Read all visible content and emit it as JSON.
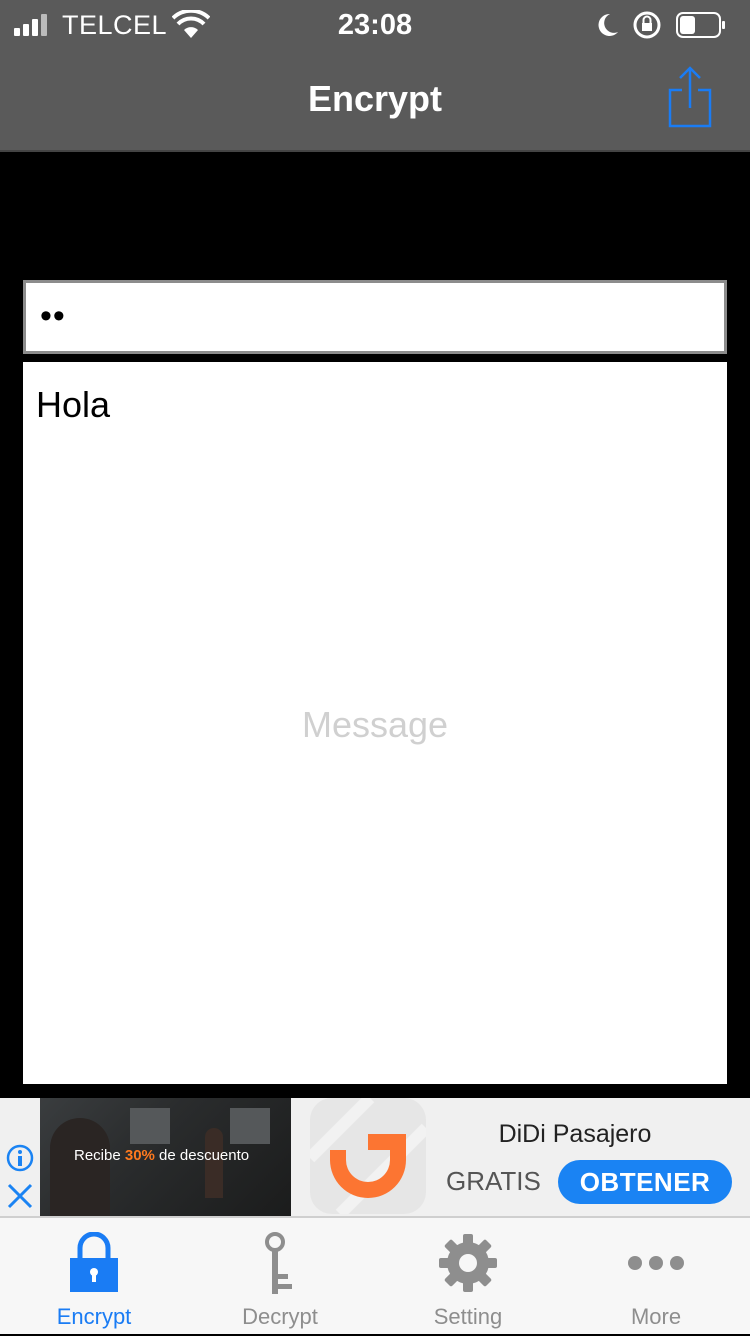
{
  "status": {
    "carrier": "TELCEL",
    "time": "23:08"
  },
  "navbar": {
    "title": "Encrypt",
    "share_icon": "share-icon"
  },
  "form": {
    "password_value": "••",
    "message_value": "Hola",
    "message_placeholder": "Message"
  },
  "ad": {
    "caption_prefix": "Recibe ",
    "caption_highlight": "30%",
    "caption_suffix": " de descuento",
    "app_name": "DiDi Pasajero",
    "price": "GRATIS",
    "button": "OBTENER",
    "highlight_color": "#ff7a1e",
    "button_color": "#1a83f3"
  },
  "tabs": [
    {
      "label": "Encrypt",
      "icon": "lock-icon",
      "active": true
    },
    {
      "label": "Decrypt",
      "icon": "key-icon",
      "active": false
    },
    {
      "label": "Setting",
      "icon": "gear-icon",
      "active": false
    },
    {
      "label": "More",
      "icon": "more-icon",
      "active": false
    }
  ],
  "colors": {
    "accent": "#1a7cf4",
    "navbar": "#5a5a5a",
    "inactive_tab": "#8e8e8e"
  }
}
